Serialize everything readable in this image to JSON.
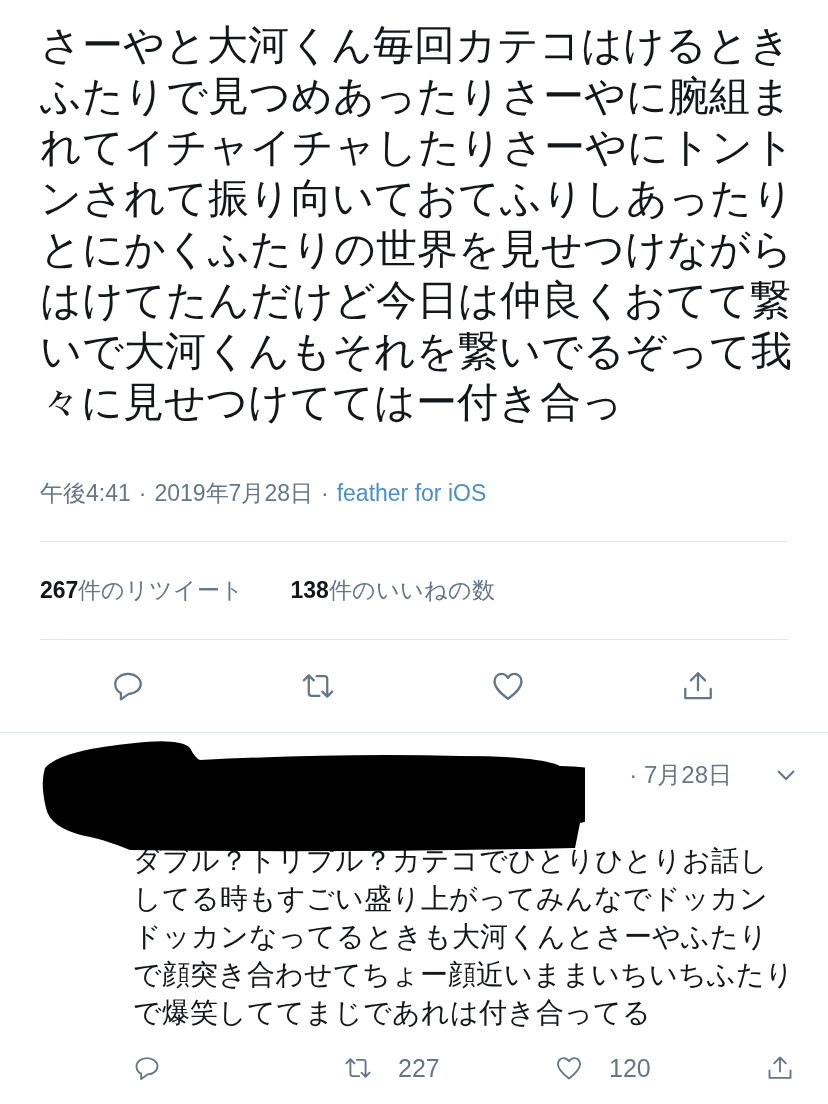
{
  "tweet": {
    "text": "さーやと大河くん毎回カテコはけるときふたりで見つめあったりさーやに腕組まれてイチャイチャしたりさーやにトントンされて振り向いておてふりしあったりとにかくふたりの世界を見せつけながらはけてたんだけど今日は仲良くおてて繋いで大河くんもそれを繋いでるぞって我々に見せつけててはー付き合っ",
    "meta": [
      {
        "kind": "text",
        "text": "午後4:41"
      },
      {
        "kind": "text",
        "text": "·"
      },
      {
        "kind": "text",
        "text": "2019年7月28日"
      },
      {
        "kind": "text",
        "text": "·"
      },
      {
        "kind": "link",
        "text": "feather for iOS"
      }
    ],
    "stats": [
      "**267**件のリツイート",
      "**138**件のいいねの数"
    ],
    "actions": [
      {
        "kind": "reply"
      },
      {
        "kind": "retweet"
      },
      {
        "kind": "like"
      },
      {
        "kind": "share"
      }
    ]
  },
  "reply": {
    "date": "· 7月28日",
    "text": "ダブル？トリプル？カテコでひとりひとりお話ししてる時もすごい盛り上がってみんなでドッカンドッカンなってるときも大河くんとさーやふたりで顔突き合わせてちょー顔近いままいちいちふたりで爆笑しててまじであれは付き合ってる",
    "actions": [
      {
        "kind": "reply"
      },
      {
        "kind": "retweet",
        "count": "227"
      },
      {
        "kind": "like",
        "count": "120"
      },
      {
        "kind": "share"
      }
    ]
  }
}
